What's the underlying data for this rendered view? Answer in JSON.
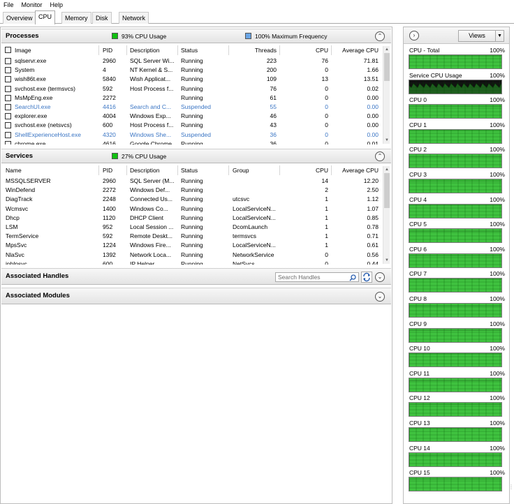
{
  "menu": [
    "File",
    "Monitor",
    "Help"
  ],
  "tabs": [
    {
      "label": "Overview",
      "active": false
    },
    {
      "label": "CPU",
      "active": true
    },
    {
      "label": "Memory",
      "active": false
    },
    {
      "label": "Disk",
      "active": false
    },
    {
      "label": "Network",
      "active": false
    }
  ],
  "processes": {
    "title": "Processes",
    "cpu_usage": "93% CPU Usage",
    "max_freq": "100% Maximum Frequency",
    "cpu_usage_color": "#10c010",
    "max_freq_color": "#6aa6e6",
    "columns": [
      "Image",
      "PID",
      "Description",
      "Status",
      "Threads",
      "CPU",
      "Average CPU"
    ],
    "rows": [
      {
        "image": "sqlservr.exe",
        "pid": "2960",
        "desc": "SQL Server Wi...",
        "status": "Running",
        "threads": "223",
        "cpu": "76",
        "avg": "71.81",
        "suspended": false
      },
      {
        "image": "System",
        "pid": "4",
        "desc": "NT Kernel & S...",
        "status": "Running",
        "threads": "200",
        "cpu": "0",
        "avg": "1.66",
        "suspended": false
      },
      {
        "image": "wish86t.exe",
        "pid": "5840",
        "desc": "Wish Applicat...",
        "status": "Running",
        "threads": "109",
        "cpu": "13",
        "avg": "13.51",
        "suspended": false
      },
      {
        "image": "svchost.exe (termsvcs)",
        "pid": "592",
        "desc": "Host Process f...",
        "status": "Running",
        "threads": "76",
        "cpu": "0",
        "avg": "0.02",
        "suspended": false
      },
      {
        "image": "MsMpEng.exe",
        "pid": "2272",
        "desc": "",
        "status": "Running",
        "threads": "61",
        "cpu": "0",
        "avg": "0.00",
        "suspended": false
      },
      {
        "image": "SearchUI.exe",
        "pid": "4416",
        "desc": "Search and C...",
        "status": "Suspended",
        "threads": "55",
        "cpu": "0",
        "avg": "0.00",
        "suspended": true
      },
      {
        "image": "explorer.exe",
        "pid": "4004",
        "desc": "Windows Exp...",
        "status": "Running",
        "threads": "46",
        "cpu": "0",
        "avg": "0.00",
        "suspended": false
      },
      {
        "image": "svchost.exe (netsvcs)",
        "pid": "600",
        "desc": "Host Process f...",
        "status": "Running",
        "threads": "43",
        "cpu": "0",
        "avg": "0.00",
        "suspended": false
      },
      {
        "image": "ShellExperienceHost.exe",
        "pid": "4320",
        "desc": "Windows She...",
        "status": "Suspended",
        "threads": "36",
        "cpu": "0",
        "avg": "0.00",
        "suspended": true
      },
      {
        "image": "chrome.exe",
        "pid": "4616",
        "desc": "Google Chrome",
        "status": "Running",
        "threads": "36",
        "cpu": "0",
        "avg": "0.01",
        "suspended": false
      }
    ]
  },
  "services": {
    "title": "Services",
    "cpu_usage": "27% CPU Usage",
    "cpu_usage_color": "#10c010",
    "columns": [
      "Name",
      "PID",
      "Description",
      "Status",
      "Group",
      "CPU",
      "Average CPU"
    ],
    "rows": [
      {
        "name": "MSSQLSERVER",
        "pid": "2960",
        "desc": "SQL Server (M...",
        "status": "Running",
        "group": "",
        "cpu": "14",
        "avg": "12.20"
      },
      {
        "name": "WinDefend",
        "pid": "2272",
        "desc": "Windows Def...",
        "status": "Running",
        "group": "",
        "cpu": "2",
        "avg": "2.50"
      },
      {
        "name": "DiagTrack",
        "pid": "2248",
        "desc": "Connected Us...",
        "status": "Running",
        "group": "utcsvc",
        "cpu": "1",
        "avg": "1.12"
      },
      {
        "name": "Wcmsvc",
        "pid": "1400",
        "desc": "Windows Co...",
        "status": "Running",
        "group": "LocalServiceN...",
        "cpu": "1",
        "avg": "1.07"
      },
      {
        "name": "Dhcp",
        "pid": "1120",
        "desc": "DHCP Client",
        "status": "Running",
        "group": "LocalServiceN...",
        "cpu": "1",
        "avg": "0.85"
      },
      {
        "name": "LSM",
        "pid": "952",
        "desc": "Local Session ...",
        "status": "Running",
        "group": "DcomLaunch",
        "cpu": "1",
        "avg": "0.78"
      },
      {
        "name": "TermService",
        "pid": "592",
        "desc": "Remote Deskt...",
        "status": "Running",
        "group": "termsvcs",
        "cpu": "1",
        "avg": "0.71"
      },
      {
        "name": "MpsSvc",
        "pid": "1224",
        "desc": "Windows Fire...",
        "status": "Running",
        "group": "LocalServiceN...",
        "cpu": "1",
        "avg": "0.61"
      },
      {
        "name": "NlaSvc",
        "pid": "1392",
        "desc": "Network Loca...",
        "status": "Running",
        "group": "NetworkService",
        "cpu": "0",
        "avg": "0.56"
      },
      {
        "name": "iphlpsvc",
        "pid": "600",
        "desc": "IP Helper",
        "status": "Running",
        "group": "NetSvcs",
        "cpu": "0",
        "avg": "0.44"
      }
    ]
  },
  "handles": {
    "title": "Associated Handles",
    "search_placeholder": "Search Handles"
  },
  "modules": {
    "title": "Associated Modules"
  },
  "right_panel": {
    "views_label": "Views",
    "graph_fill_color": "#3fc23f",
    "service_graph_color": "#1f5f1f",
    "graphs": [
      {
        "label": "CPU - Total",
        "percent": "100%"
      },
      {
        "label": "Service CPU Usage",
        "percent": "100%"
      },
      {
        "label": "CPU 0",
        "percent": "100%"
      },
      {
        "label": "CPU 1",
        "percent": "100%"
      },
      {
        "label": "CPU 2",
        "percent": "100%"
      },
      {
        "label": "CPU 3",
        "percent": "100%"
      },
      {
        "label": "CPU 4",
        "percent": "100%"
      },
      {
        "label": "CPU 5",
        "percent": "100%"
      },
      {
        "label": "CPU 6",
        "percent": "100%"
      },
      {
        "label": "CPU 7",
        "percent": "100%"
      },
      {
        "label": "CPU 8",
        "percent": "100%"
      },
      {
        "label": "CPU 9",
        "percent": "100%"
      },
      {
        "label": "CPU 10",
        "percent": "100%"
      },
      {
        "label": "CPU 11",
        "percent": "100%"
      },
      {
        "label": "CPU 12",
        "percent": "100%"
      },
      {
        "label": "CPU 13",
        "percent": "100%"
      },
      {
        "label": "CPU 14",
        "percent": "100%"
      },
      {
        "label": "CPU 15",
        "percent": "100%"
      }
    ]
  }
}
